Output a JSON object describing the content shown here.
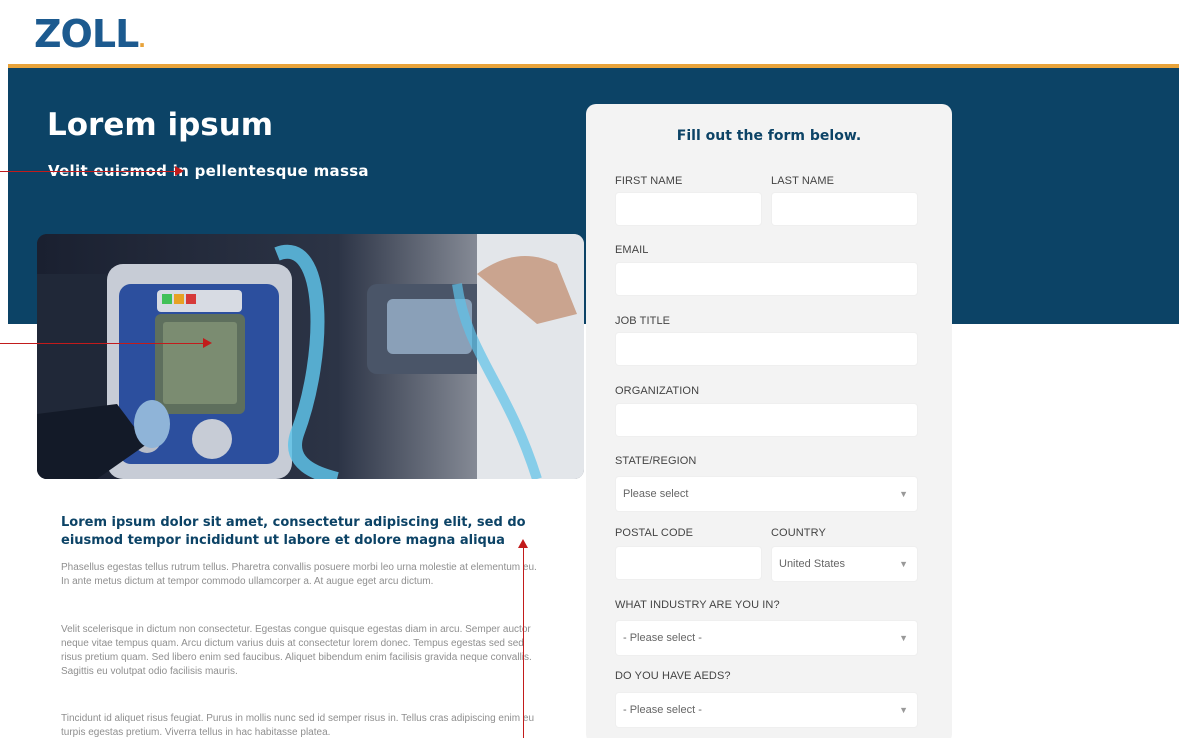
{
  "header": {
    "logo_text": "ZOLL",
    "logo_dot": "."
  },
  "hero": {
    "title": "Lorem ipsum",
    "subtitle": "Velit euismod in pellentesque massa"
  },
  "content": {
    "heading": "Lorem ipsum dolor sit amet, consectetur adipiscing elit, sed do eiusmod tempor incididunt ut labore et dolore magna aliqua",
    "paragraphs": [
      "Phasellus egestas tellus rutrum tellus. Pharetra convallis posuere morbi leo urna molestie at elementum eu. In ante metus dictum at tempor commodo ullamcorper a. At augue eget arcu dictum.",
      "Velit scelerisque in dictum non consectetur. Egestas congue quisque egestas diam in arcu. Semper auctor neque vitae tempus quam. Arcu dictum varius duis at consectetur lorem donec. Tempus egestas sed sed risus pretium quam. Sed libero enim sed faucibus. Aliquet bibendum enim facilisis gravida neque convallis. Sagittis eu volutpat odio facilisis mauris.",
      "Tincidunt id aliquet risus feugiat. Purus in mollis nunc sed id semper risus in. Tellus cras adipiscing enim eu turpis egestas pretium. Viverra tellus in hac habitasse platea."
    ]
  },
  "form": {
    "title": "Fill out the form below.",
    "first_name_label": "FIRST NAME",
    "last_name_label": "LAST NAME",
    "email_label": "EMAIL",
    "job_title_label": "JOB TITLE",
    "organization_label": "ORGANIZATION",
    "state_label": "STATE/REGION",
    "state_value": "Please select",
    "postal_label": "POSTAL CODE",
    "country_label": "COUNTRY",
    "country_value": "United States",
    "industry_label": "WHAT INDUSTRY ARE YOU IN?",
    "industry_value": "- Please select -",
    "aeds_label": "DO YOU HAVE AEDS?",
    "aeds_value": "- Please select -"
  },
  "colors": {
    "brand_blue": "#0c4366",
    "logo_blue": "#1c5a8f",
    "accent_orange": "#e8a33a",
    "annotation_red": "#c21b1b"
  },
  "icons": [
    "caret-down-icon"
  ]
}
